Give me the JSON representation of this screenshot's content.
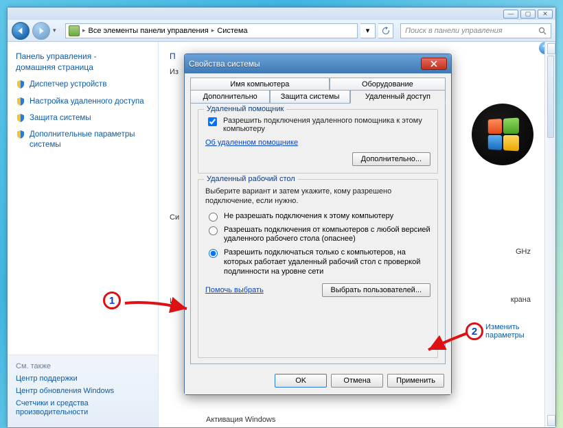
{
  "window": {
    "btn_min": "—",
    "btn_max": "▢",
    "btn_close": "✕"
  },
  "address": {
    "crumb1": "Все элементы панели управления",
    "crumb2": "Система",
    "search_placeholder": "Поиск в панели управления"
  },
  "sidebar": {
    "home_line1": "Панель управления -",
    "home_line2": "домашняя страница",
    "links": [
      "Диспетчер устройств",
      "Настройка удаленного доступа",
      "Защита системы",
      "Дополнительные параметры системы"
    ]
  },
  "see_also": {
    "header": "См. также",
    "items": [
      "Центр поддержки",
      "Центр обновления Windows",
      "Счетчики и средства производительности"
    ]
  },
  "main": {
    "heading_cut": "П",
    "sub_cut": "Из",
    "sys_cut": "Си",
    "name_cut": "И",
    "ghz": "GHz",
    "screen_cut": "крана",
    "change_label": "Изменить параметры",
    "activation": "Активация Windows"
  },
  "dialog": {
    "title": "Свойства системы",
    "tabs_row1": [
      "Имя компьютера",
      "Оборудование"
    ],
    "tabs_row2": [
      "Дополнительно",
      "Защита системы",
      "Удаленный доступ"
    ],
    "group1": {
      "legend": "Удаленный помощник",
      "chk_label": "Разрешить подключения удаленного помощника к этому компьютеру",
      "about_link": "Об удаленном помощнике",
      "adv_btn": "Дополнительно..."
    },
    "group2": {
      "legend": "Удаленный рабочий стол",
      "desc": "Выберите вариант и затем укажите, кому разрешено подключение, если нужно.",
      "opt1": "Не разрешать подключения к этому компьютеру",
      "opt2": "Разрешать подключения от компьютеров с любой версией удаленного рабочего стола (опаснее)",
      "opt3": "Разрешить подключаться только с компьютеров, на которых работает удаленный рабочий стол с проверкой подлинности на уровне сети",
      "help_link": "Помочь выбрать",
      "users_btn": "Выбрать пользователей..."
    },
    "footer": {
      "ok": "OK",
      "cancel": "Отмена",
      "apply": "Применить"
    }
  },
  "annotations": {
    "one": "1",
    "two": "2"
  }
}
